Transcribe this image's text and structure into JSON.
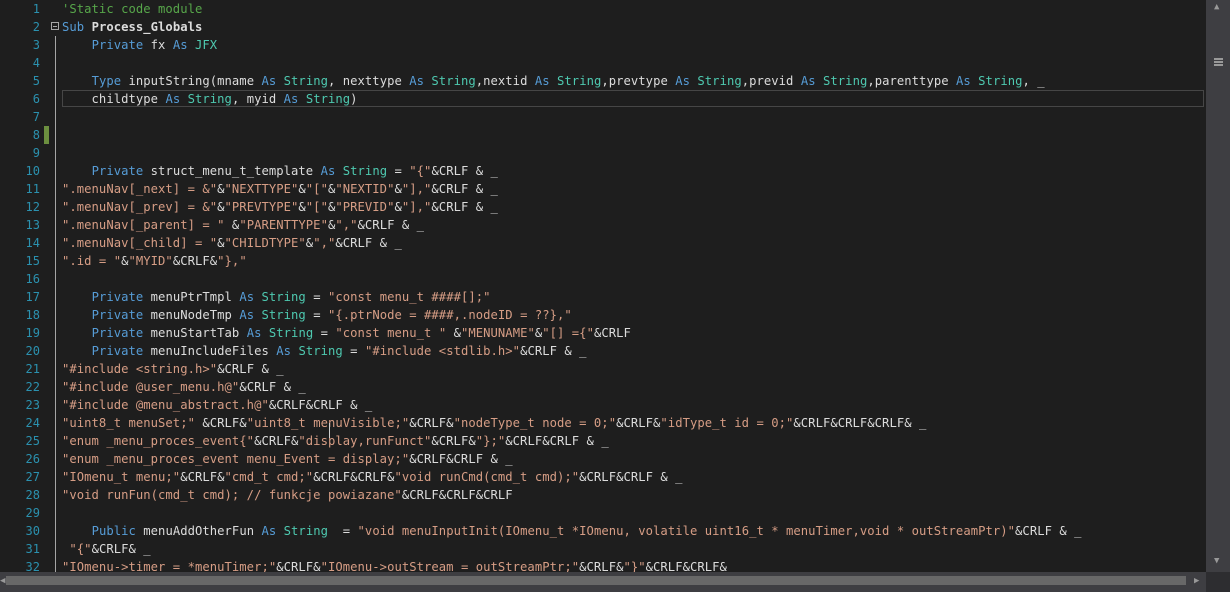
{
  "editor": {
    "lines": [
      {
        "n": "1",
        "t": [
          [
            "cm",
            "'Static code module"
          ]
        ]
      },
      {
        "n": "2",
        "t": [
          [
            "kw",
            "Sub "
          ],
          [
            "fn",
            "Process_Globals"
          ]
        ]
      },
      {
        "n": "3",
        "t": [
          [
            "id",
            "    "
          ],
          [
            "kw",
            "Private "
          ],
          [
            "id",
            "fx "
          ],
          [
            "kw",
            "As "
          ],
          [
            "ty",
            "JFX"
          ]
        ]
      },
      {
        "n": "4",
        "t": []
      },
      {
        "n": "5",
        "t": [
          [
            "id",
            "    "
          ],
          [
            "kw",
            "Type "
          ],
          [
            "id",
            "inputString(mname "
          ],
          [
            "kw",
            "As "
          ],
          [
            "ty",
            "String"
          ],
          [
            "id",
            ", nexttype "
          ],
          [
            "kw",
            "As "
          ],
          [
            "ty",
            "String"
          ],
          [
            "id",
            ",nextid "
          ],
          [
            "kw",
            "As "
          ],
          [
            "ty",
            "String"
          ],
          [
            "id",
            ",prevtype "
          ],
          [
            "kw",
            "As "
          ],
          [
            "ty",
            "String"
          ],
          [
            "id",
            ",previd "
          ],
          [
            "kw",
            "As "
          ],
          [
            "ty",
            "String"
          ],
          [
            "id",
            ",parenttype "
          ],
          [
            "kw",
            "As "
          ],
          [
            "ty",
            "String"
          ],
          [
            "id",
            ", _"
          ]
        ]
      },
      {
        "n": "6",
        "t": [
          [
            "id",
            "    childtype "
          ],
          [
            "kw",
            "As "
          ],
          [
            "ty",
            "String"
          ],
          [
            "id",
            ", myid "
          ],
          [
            "kw",
            "As "
          ],
          [
            "ty",
            "String"
          ],
          [
            "id",
            ")"
          ]
        ]
      },
      {
        "n": "7",
        "t": []
      },
      {
        "n": "8",
        "t": []
      },
      {
        "n": "9",
        "t": []
      },
      {
        "n": "10",
        "t": [
          [
            "id",
            "    "
          ],
          [
            "kw",
            "Private "
          ],
          [
            "id",
            "struct_menu_t_template "
          ],
          [
            "kw",
            "As "
          ],
          [
            "ty",
            "String "
          ],
          [
            "id",
            "= "
          ],
          [
            "st",
            "\"{\""
          ],
          [
            "id",
            "&CRLF & _"
          ]
        ]
      },
      {
        "n": "11",
        "t": [
          [
            "st",
            "\".menuNav[_next] = &\""
          ],
          [
            "id",
            "&"
          ],
          [
            "st",
            "\"NEXTTYPE\""
          ],
          [
            "id",
            "&"
          ],
          [
            "st",
            "\"[\""
          ],
          [
            "id",
            "&"
          ],
          [
            "st",
            "\"NEXTID\""
          ],
          [
            "id",
            "&"
          ],
          [
            "st",
            "\"],\""
          ],
          [
            "id",
            "&CRLF & _"
          ]
        ]
      },
      {
        "n": "12",
        "t": [
          [
            "st",
            "\".menuNav[_prev] = &\""
          ],
          [
            "id",
            "&"
          ],
          [
            "st",
            "\"PREVTYPE\""
          ],
          [
            "id",
            "&"
          ],
          [
            "st",
            "\"[\""
          ],
          [
            "id",
            "&"
          ],
          [
            "st",
            "\"PREVID\""
          ],
          [
            "id",
            "&"
          ],
          [
            "st",
            "\"],\""
          ],
          [
            "id",
            "&CRLF & _"
          ]
        ]
      },
      {
        "n": "13",
        "t": [
          [
            "st",
            "\".menuNav[_parent] = \" "
          ],
          [
            "id",
            "&"
          ],
          [
            "st",
            "\"PARENTTYPE\""
          ],
          [
            "id",
            "&"
          ],
          [
            "st",
            "\",\""
          ],
          [
            "id",
            "&CRLF & _"
          ]
        ]
      },
      {
        "n": "14",
        "t": [
          [
            "st",
            "\".menuNav[_child] = \""
          ],
          [
            "id",
            "&"
          ],
          [
            "st",
            "\"CHILDTYPE\""
          ],
          [
            "id",
            "&"
          ],
          [
            "st",
            "\",\""
          ],
          [
            "id",
            "&CRLF & _"
          ]
        ]
      },
      {
        "n": "15",
        "t": [
          [
            "st",
            "\".id = \""
          ],
          [
            "id",
            "&"
          ],
          [
            "st",
            "\"MYID\""
          ],
          [
            "id",
            "&CRLF&"
          ],
          [
            "st",
            "\"},\""
          ]
        ]
      },
      {
        "n": "16",
        "t": []
      },
      {
        "n": "17",
        "t": [
          [
            "id",
            "    "
          ],
          [
            "kw",
            "Private "
          ],
          [
            "id",
            "menuPtrTmpl "
          ],
          [
            "kw",
            "As "
          ],
          [
            "ty",
            "String "
          ],
          [
            "id",
            "= "
          ],
          [
            "st",
            "\"const menu_t ####[];\""
          ]
        ]
      },
      {
        "n": "18",
        "t": [
          [
            "id",
            "    "
          ],
          [
            "kw",
            "Private "
          ],
          [
            "id",
            "menuNodeTmp "
          ],
          [
            "kw",
            "As "
          ],
          [
            "ty",
            "String "
          ],
          [
            "id",
            "= "
          ],
          [
            "st",
            "\"{.ptrNode = ####,.nodeID = ??},\""
          ]
        ]
      },
      {
        "n": "19",
        "t": [
          [
            "id",
            "    "
          ],
          [
            "kw",
            "Private "
          ],
          [
            "id",
            "menuStartTab "
          ],
          [
            "kw",
            "As "
          ],
          [
            "ty",
            "String "
          ],
          [
            "id",
            "= "
          ],
          [
            "st",
            "\"const menu_t \" "
          ],
          [
            "id",
            "&"
          ],
          [
            "st",
            "\"MENUNAME\""
          ],
          [
            "id",
            "&"
          ],
          [
            "st",
            "\"[] ={\""
          ],
          [
            "id",
            "&CRLF"
          ]
        ]
      },
      {
        "n": "20",
        "t": [
          [
            "id",
            "    "
          ],
          [
            "kw",
            "Private "
          ],
          [
            "id",
            "menuIncludeFiles "
          ],
          [
            "kw",
            "As "
          ],
          [
            "ty",
            "String "
          ],
          [
            "id",
            "= "
          ],
          [
            "st",
            "\"#include <stdlib.h>\""
          ],
          [
            "id",
            "&CRLF & _"
          ]
        ]
      },
      {
        "n": "21",
        "t": [
          [
            "st",
            "\"#include <string.h>\""
          ],
          [
            "id",
            "&CRLF & _"
          ]
        ]
      },
      {
        "n": "22",
        "t": [
          [
            "st",
            "\"#include @user_menu.h@\""
          ],
          [
            "id",
            "&CRLF & _"
          ]
        ]
      },
      {
        "n": "23",
        "t": [
          [
            "st",
            "\"#include @menu_abstract.h@\""
          ],
          [
            "id",
            "&CRLF&CRLF & _"
          ]
        ]
      },
      {
        "n": "24",
        "t": [
          [
            "st",
            "\"uint8_t menuSet;\" "
          ],
          [
            "id",
            "&CRLF&"
          ],
          [
            "st",
            "\"uint8_t menuVisible;\""
          ],
          [
            "id",
            "&CRLF&"
          ],
          [
            "st",
            "\"nodeType_t node = 0;\""
          ],
          [
            "id",
            "&CRLF&"
          ],
          [
            "st",
            "\"idType_t id = 0;\""
          ],
          [
            "id",
            "&CRLF&CRLF&CRLF& _"
          ]
        ]
      },
      {
        "n": "25",
        "t": [
          [
            "st",
            "\"enum _menu_proces_event{\""
          ],
          [
            "id",
            "&CRLF&"
          ],
          [
            "st",
            "\"display,runFunct\""
          ],
          [
            "id",
            "&CRLF&"
          ],
          [
            "st",
            "\"};\""
          ],
          [
            "id",
            "&CRLF&CRLF & _"
          ]
        ]
      },
      {
        "n": "26",
        "t": [
          [
            "st",
            "\"enum _menu_proces_event menu_Event = display;\""
          ],
          [
            "id",
            "&CRLF&CRLF & _"
          ]
        ]
      },
      {
        "n": "27",
        "t": [
          [
            "st",
            "\"IOmenu_t menu;\""
          ],
          [
            "id",
            "&CRLF&"
          ],
          [
            "st",
            "\"cmd_t cmd;\""
          ],
          [
            "id",
            "&CRLF&CRLF&"
          ],
          [
            "st",
            "\"void runCmd(cmd_t cmd);\""
          ],
          [
            "id",
            "&CRLF&CRLF & _"
          ]
        ]
      },
      {
        "n": "28",
        "t": [
          [
            "st",
            "\"void runFun(cmd_t cmd); // funkcje powiazane\""
          ],
          [
            "id",
            "&CRLF&CRLF&CRLF"
          ]
        ]
      },
      {
        "n": "29",
        "t": []
      },
      {
        "n": "30",
        "t": [
          [
            "id",
            "    "
          ],
          [
            "kw",
            "Public "
          ],
          [
            "id",
            "menuAddOtherFun "
          ],
          [
            "kw",
            "As "
          ],
          [
            "ty",
            "String "
          ],
          [
            "id",
            " = "
          ],
          [
            "st",
            "\"void menuInputInit(IOmenu_t *IOmenu, volatile uint16_t * menuTimer,void * outStreamPtr)\""
          ],
          [
            "id",
            "&CRLF & _"
          ]
        ]
      },
      {
        "n": "31",
        "t": [
          [
            "id",
            " "
          ],
          [
            "st",
            "\"{\""
          ],
          [
            "id",
            "&CRLF& _"
          ]
        ]
      },
      {
        "n": "32",
        "t": [
          [
            "st",
            "\"IOmenu->timer = *menuTimer;\""
          ],
          [
            "id",
            "&CRLF&"
          ],
          [
            "st",
            "\"IOmenu->outStream = outStreamPtr;\""
          ],
          [
            "id",
            "&CRLF&"
          ],
          [
            "st",
            "\"}\""
          ],
          [
            "id",
            "&CRLF&CRLF&"
          ]
        ]
      }
    ]
  }
}
